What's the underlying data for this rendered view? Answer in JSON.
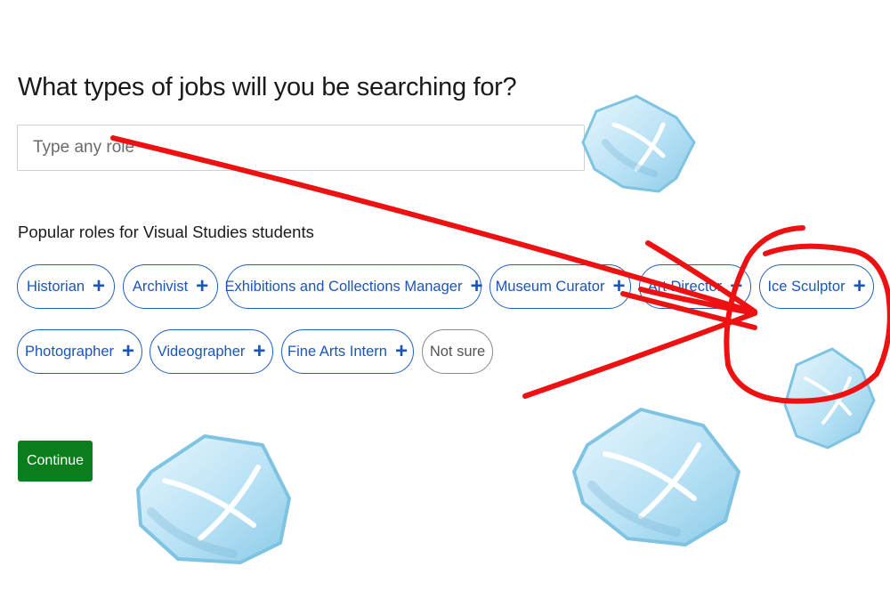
{
  "heading": "What types of jobs will you be searching for?",
  "search": {
    "placeholder": "Type any role"
  },
  "popular_label": "Popular roles for Visual Studies students",
  "roles": [
    "Historian",
    "Archivist",
    "Exhibitions and Collections Manager",
    "Museum Curator",
    "Art Director",
    "Ice Sculptor",
    "Photographer",
    "Videographer",
    "Fine Arts Intern"
  ],
  "not_sure": "Not sure",
  "continue_label": "Continue",
  "colors": {
    "chip_blue": "#1f5fc1",
    "continue_green": "#0a7d1c",
    "annotation_red": "#ee1111",
    "ice_blue": "#a8d8f0"
  }
}
